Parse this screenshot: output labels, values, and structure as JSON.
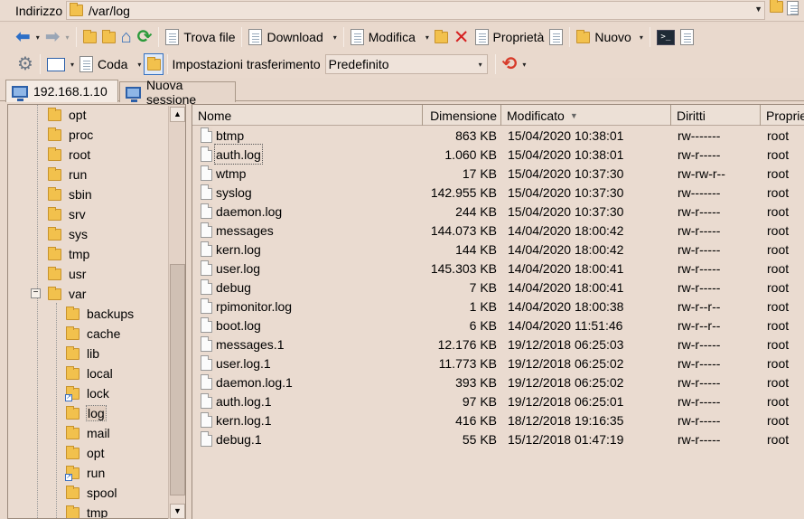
{
  "address": {
    "label": "Indirizzo",
    "path": "/var/log"
  },
  "toolbar1": {
    "find_label": "Trova file",
    "download_label": "Download",
    "edit_label": "Modifica",
    "properties_label": "Proprietà",
    "new_label": "Nuovo"
  },
  "toolbar2": {
    "queue_label": "Coda",
    "transfer_settings_label": "Impostazioni trasferimento",
    "transfer_preset": "Predefinito"
  },
  "tabs": [
    {
      "label": "192.168.1.10",
      "active": true
    },
    {
      "label": "Nuova sessione",
      "active": false
    }
  ],
  "tree": [
    {
      "label": "opt"
    },
    {
      "label": "proc"
    },
    {
      "label": "root"
    },
    {
      "label": "run"
    },
    {
      "label": "sbin"
    },
    {
      "label": "srv"
    },
    {
      "label": "sys"
    },
    {
      "label": "tmp"
    },
    {
      "label": "usr"
    },
    {
      "label": "var"
    }
  ],
  "tree_children": [
    {
      "label": "backups"
    },
    {
      "label": "cache"
    },
    {
      "label": "lib"
    },
    {
      "label": "local"
    },
    {
      "label": "lock",
      "link": true
    },
    {
      "label": "log",
      "selected": true
    },
    {
      "label": "mail"
    },
    {
      "label": "opt"
    },
    {
      "label": "run",
      "link": true
    },
    {
      "label": "spool"
    },
    {
      "label": "tmp"
    }
  ],
  "columns": {
    "name": "Nome",
    "size": "Dimensione",
    "modified": "Modificato",
    "rights": "Diritti",
    "owner": "Proprie"
  },
  "files": [
    {
      "name": "btmp",
      "size": "863 KB",
      "modified": "15/04/2020 10:38:01",
      "rights": "rw-------",
      "owner": "root"
    },
    {
      "name": "auth.log",
      "size": "1.060 KB",
      "modified": "15/04/2020 10:38:01",
      "rights": "rw-r-----",
      "owner": "root",
      "focus": true
    },
    {
      "name": "wtmp",
      "size": "17 KB",
      "modified": "15/04/2020 10:37:30",
      "rights": "rw-rw-r--",
      "owner": "root"
    },
    {
      "name": "syslog",
      "size": "142.955 KB",
      "modified": "15/04/2020 10:37:30",
      "rights": "rw-------",
      "owner": "root"
    },
    {
      "name": "daemon.log",
      "size": "244 KB",
      "modified": "15/04/2020 10:37:30",
      "rights": "rw-r-----",
      "owner": "root"
    },
    {
      "name": "messages",
      "size": "144.073 KB",
      "modified": "14/04/2020 18:00:42",
      "rights": "rw-r-----",
      "owner": "root"
    },
    {
      "name": "kern.log",
      "size": "144 KB",
      "modified": "14/04/2020 18:00:42",
      "rights": "rw-r-----",
      "owner": "root"
    },
    {
      "name": "user.log",
      "size": "145.303 KB",
      "modified": "14/04/2020 18:00:41",
      "rights": "rw-r-----",
      "owner": "root"
    },
    {
      "name": "debug",
      "size": "7 KB",
      "modified": "14/04/2020 18:00:41",
      "rights": "rw-r-----",
      "owner": "root"
    },
    {
      "name": "rpimonitor.log",
      "size": "1 KB",
      "modified": "14/04/2020 18:00:38",
      "rights": "rw-r--r--",
      "owner": "root"
    },
    {
      "name": "boot.log",
      "size": "6 KB",
      "modified": "14/04/2020 11:51:46",
      "rights": "rw-r--r--",
      "owner": "root"
    },
    {
      "name": "messages.1",
      "size": "12.176 KB",
      "modified": "19/12/2018 06:25:03",
      "rights": "rw-r-----",
      "owner": "root"
    },
    {
      "name": "user.log.1",
      "size": "11.773 KB",
      "modified": "19/12/2018 06:25:02",
      "rights": "rw-r-----",
      "owner": "root"
    },
    {
      "name": "daemon.log.1",
      "size": "393 KB",
      "modified": "19/12/2018 06:25:02",
      "rights": "rw-r-----",
      "owner": "root"
    },
    {
      "name": "auth.log.1",
      "size": "97 KB",
      "modified": "19/12/2018 06:25:01",
      "rights": "rw-r-----",
      "owner": "root"
    },
    {
      "name": "kern.log.1",
      "size": "416 KB",
      "modified": "18/12/2018 19:16:35",
      "rights": "rw-r-----",
      "owner": "root"
    },
    {
      "name": "debug.1",
      "size": "55 KB",
      "modified": "15/12/2018 01:47:19",
      "rights": "rw-r-----",
      "owner": "root"
    }
  ],
  "colors": {
    "background": "#e8d8cc",
    "folder": "#f3c24a",
    "accent": "#2c6fc7"
  }
}
